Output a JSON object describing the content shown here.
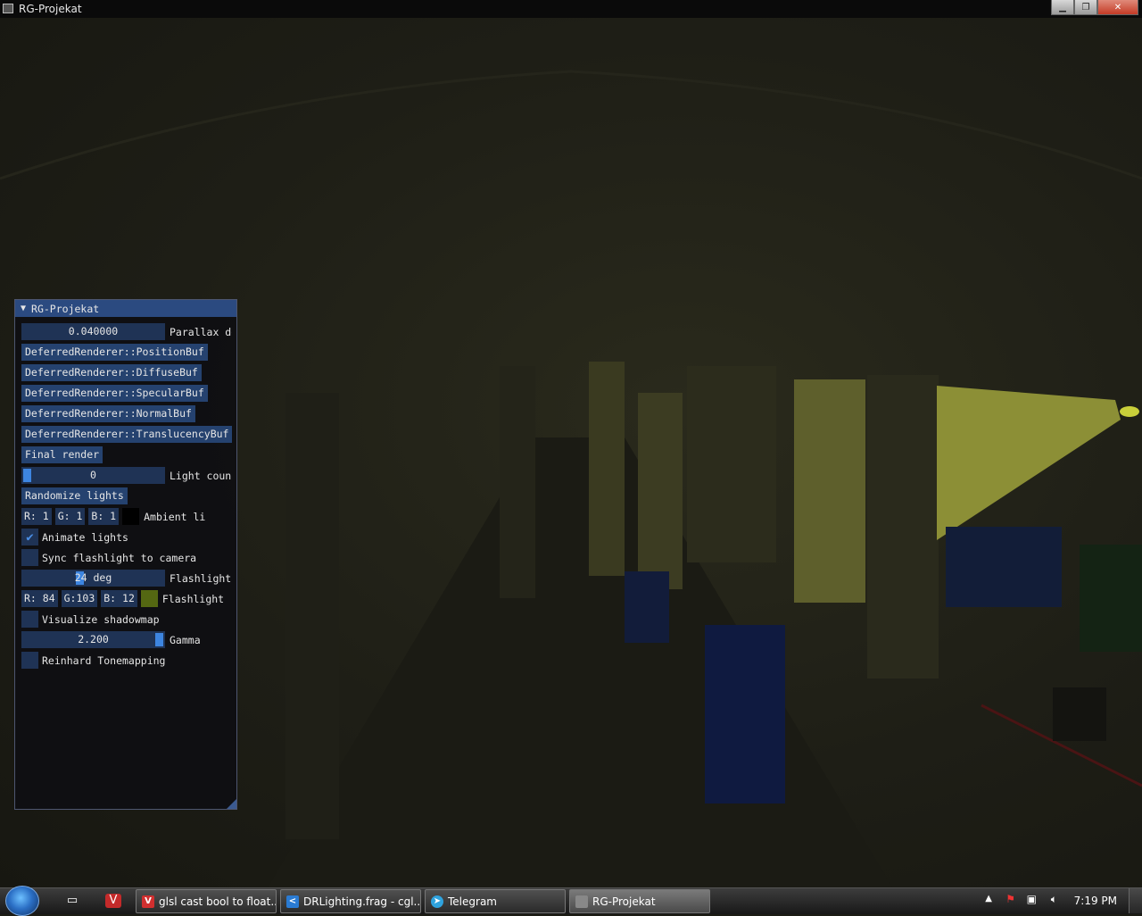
{
  "window": {
    "title": "RG-Projekat",
    "minimize": "▁",
    "maximize": "❐",
    "close": "✕"
  },
  "panel": {
    "title": "RG-Projekat",
    "parallax": {
      "value": "0.040000",
      "label": "Parallax de"
    },
    "buffers": [
      "DeferredRenderer::PositionBuf",
      "DeferredRenderer::DiffuseBuf",
      "DeferredRenderer::SpecularBuf",
      "DeferredRenderer::NormalBuf",
      "DeferredRenderer::TranslucencyBuf",
      "Final render"
    ],
    "light_count": {
      "value": "0",
      "label": "Light coun",
      "fraction": 0.0
    },
    "randomize_label": "Randomize lights",
    "ambient": {
      "r": "R:  1",
      "g": "G:  1",
      "b": "B:  1",
      "color": "#010101",
      "label": "Ambient li"
    },
    "animate_lights": {
      "label": "Animate lights",
      "checked": true,
      "check": "✔"
    },
    "sync_flashlight": {
      "label": "Sync flashlight to camera",
      "checked": false
    },
    "flashlight_angle": {
      "value": "24 deg",
      "label": "Flashlight",
      "fraction": 0.4
    },
    "flashlight_color": {
      "r": "R: 84",
      "g": "G:103",
      "b": "B: 12",
      "color": "#546712",
      "label": "Flashlight"
    },
    "visualize_shadowmap": {
      "label": "Visualize shadowmap",
      "checked": false
    },
    "gamma": {
      "value": "2.200",
      "label": "Gamma",
      "fraction": 1.0
    },
    "reinhard": {
      "label": "Reinhard Tonemapping",
      "checked": false
    }
  },
  "taskbar": {
    "items": [
      {
        "label": "glsl cast bool to float...",
        "icon": "vivaldi-icon",
        "color": "#d12f2f"
      },
      {
        "label": "DRLighting.frag - cgl...",
        "icon": "vscode-icon",
        "color": "#2a7bd3"
      },
      {
        "label": "Telegram",
        "icon": "telegram-icon",
        "color": "#2fa3de"
      },
      {
        "label": "RG-Projekat",
        "icon": "app-window-icon",
        "color": "#888888"
      }
    ],
    "clock": "7:19 PM"
  },
  "colors": {
    "accent": "#3d85e0",
    "button": "#25426f",
    "frame": "#1f3355",
    "header": "#2b4a80"
  }
}
